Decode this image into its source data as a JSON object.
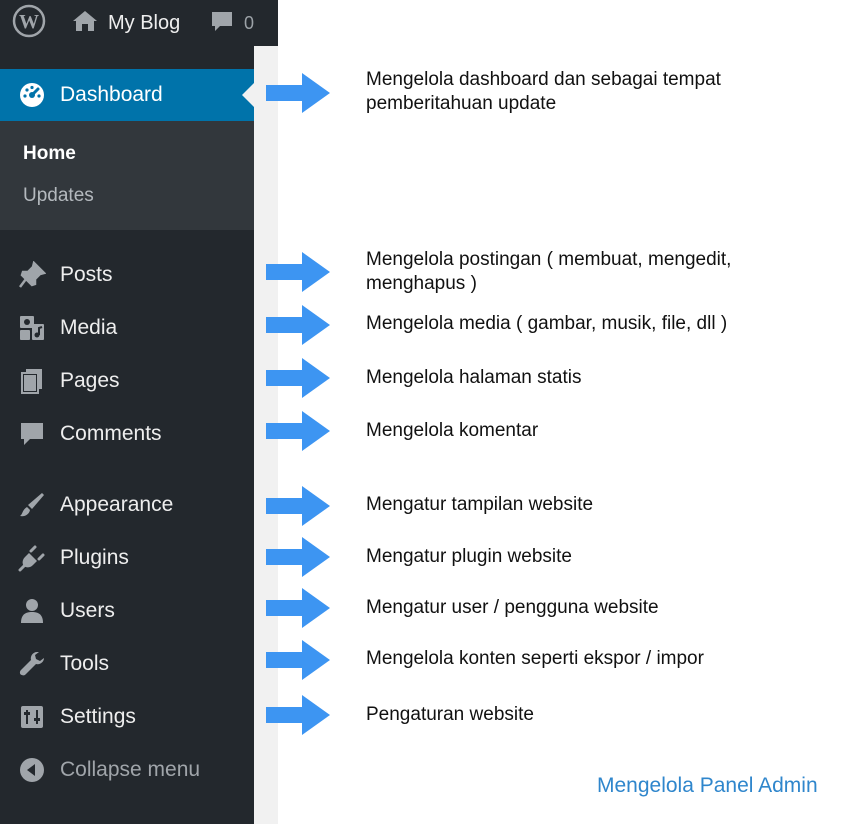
{
  "adminbar": {
    "site_name": "My Blog",
    "comment_count": "0"
  },
  "sidebar": {
    "dashboard": "Dashboard",
    "submenu": {
      "home": "Home",
      "updates": "Updates"
    },
    "items": [
      {
        "label": "Posts",
        "icon": "pin-icon"
      },
      {
        "label": "Media",
        "icon": "media-icon"
      },
      {
        "label": "Pages",
        "icon": "pages-icon"
      },
      {
        "label": "Comments",
        "icon": "comment-icon"
      },
      {
        "label": "Appearance",
        "icon": "paintbrush-icon"
      },
      {
        "label": "Plugins",
        "icon": "plug-icon"
      },
      {
        "label": "Users",
        "icon": "user-icon"
      },
      {
        "label": "Tools",
        "icon": "wrench-icon"
      },
      {
        "label": "Settings",
        "icon": "sliders-icon"
      }
    ],
    "collapse": "Collapse menu"
  },
  "notes": {
    "dashboard": "Mengelola dashboard dan sebagai tempat pemberitahuan update",
    "posts": "Mengelola postingan ( membuat, mengedit, menghapus )",
    "media": "Mengelola media ( gambar, musik, file, dll )",
    "pages": "Mengelola halaman statis",
    "comments": "Mengelola komentar",
    "appearance": "Mengatur tampilan website",
    "plugins": "Mengatur plugin website",
    "users": "Mengatur user / pengguna website",
    "tools": "Mengelola konten seperti ekspor / impor",
    "settings": "Pengaturan website"
  },
  "footer_title": "Mengelola Panel Admin",
  "colors": {
    "sidebar_bg": "#23282d",
    "active_bg": "#0073aa",
    "arrow": "#3d95f2",
    "footer_title": "#2f86cc"
  }
}
